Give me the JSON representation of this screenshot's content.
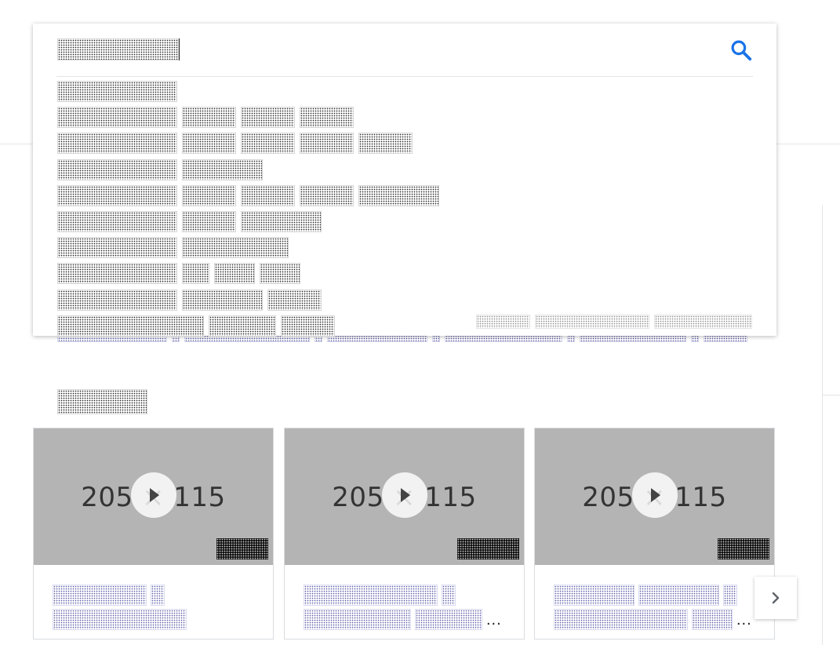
{
  "search": {
    "query": "██████████",
    "suggestions": [
      [
        "██████████"
      ],
      [
        "██████████",
        "████",
        "████",
        "████"
      ],
      [
        "██████████",
        "████",
        "████",
        "████",
        "████"
      ],
      [
        "██████████",
        "██████"
      ],
      [
        "██████████",
        "████",
        "████",
        "████",
        "██████"
      ],
      [
        "██████████",
        "████",
        "██████"
      ],
      [
        "██████████",
        "████████"
      ],
      [
        "██████████",
        "██",
        "███",
        "███"
      ],
      [
        "██████████",
        "██████",
        "████"
      ],
      [
        "████████████",
        "█████",
        "████"
      ]
    ],
    "footer_links": [
      "████",
      "██████████",
      "█████████"
    ]
  },
  "background_line": [
    "████████",
    "█",
    "██████████",
    "█",
    "██████████",
    "█",
    "██████████",
    "█",
    "████████",
    "█",
    "████"
  ],
  "videos": {
    "section_title": "████████",
    "placeholder_text": "205 × 115",
    "items": [
      {
        "duration": "████",
        "title_lines": [
          [
            "██████████",
            "█"
          ],
          [
            "██████████"
          ]
        ]
      },
      {
        "duration": "████",
        "title_lines": [
          [
            "██████████",
            "█"
          ],
          [
            "████████",
            "█████"
          ]
        ],
        "ellipsis": "..."
      },
      {
        "duration": "████",
        "title_lines": [
          [
            "██████",
            "██████",
            "█"
          ],
          [
            "██████████",
            "███"
          ]
        ],
        "ellipsis": "..."
      }
    ]
  },
  "colors": {
    "accent": "#1a73e8",
    "thumbnail": "#b4b4b4"
  }
}
